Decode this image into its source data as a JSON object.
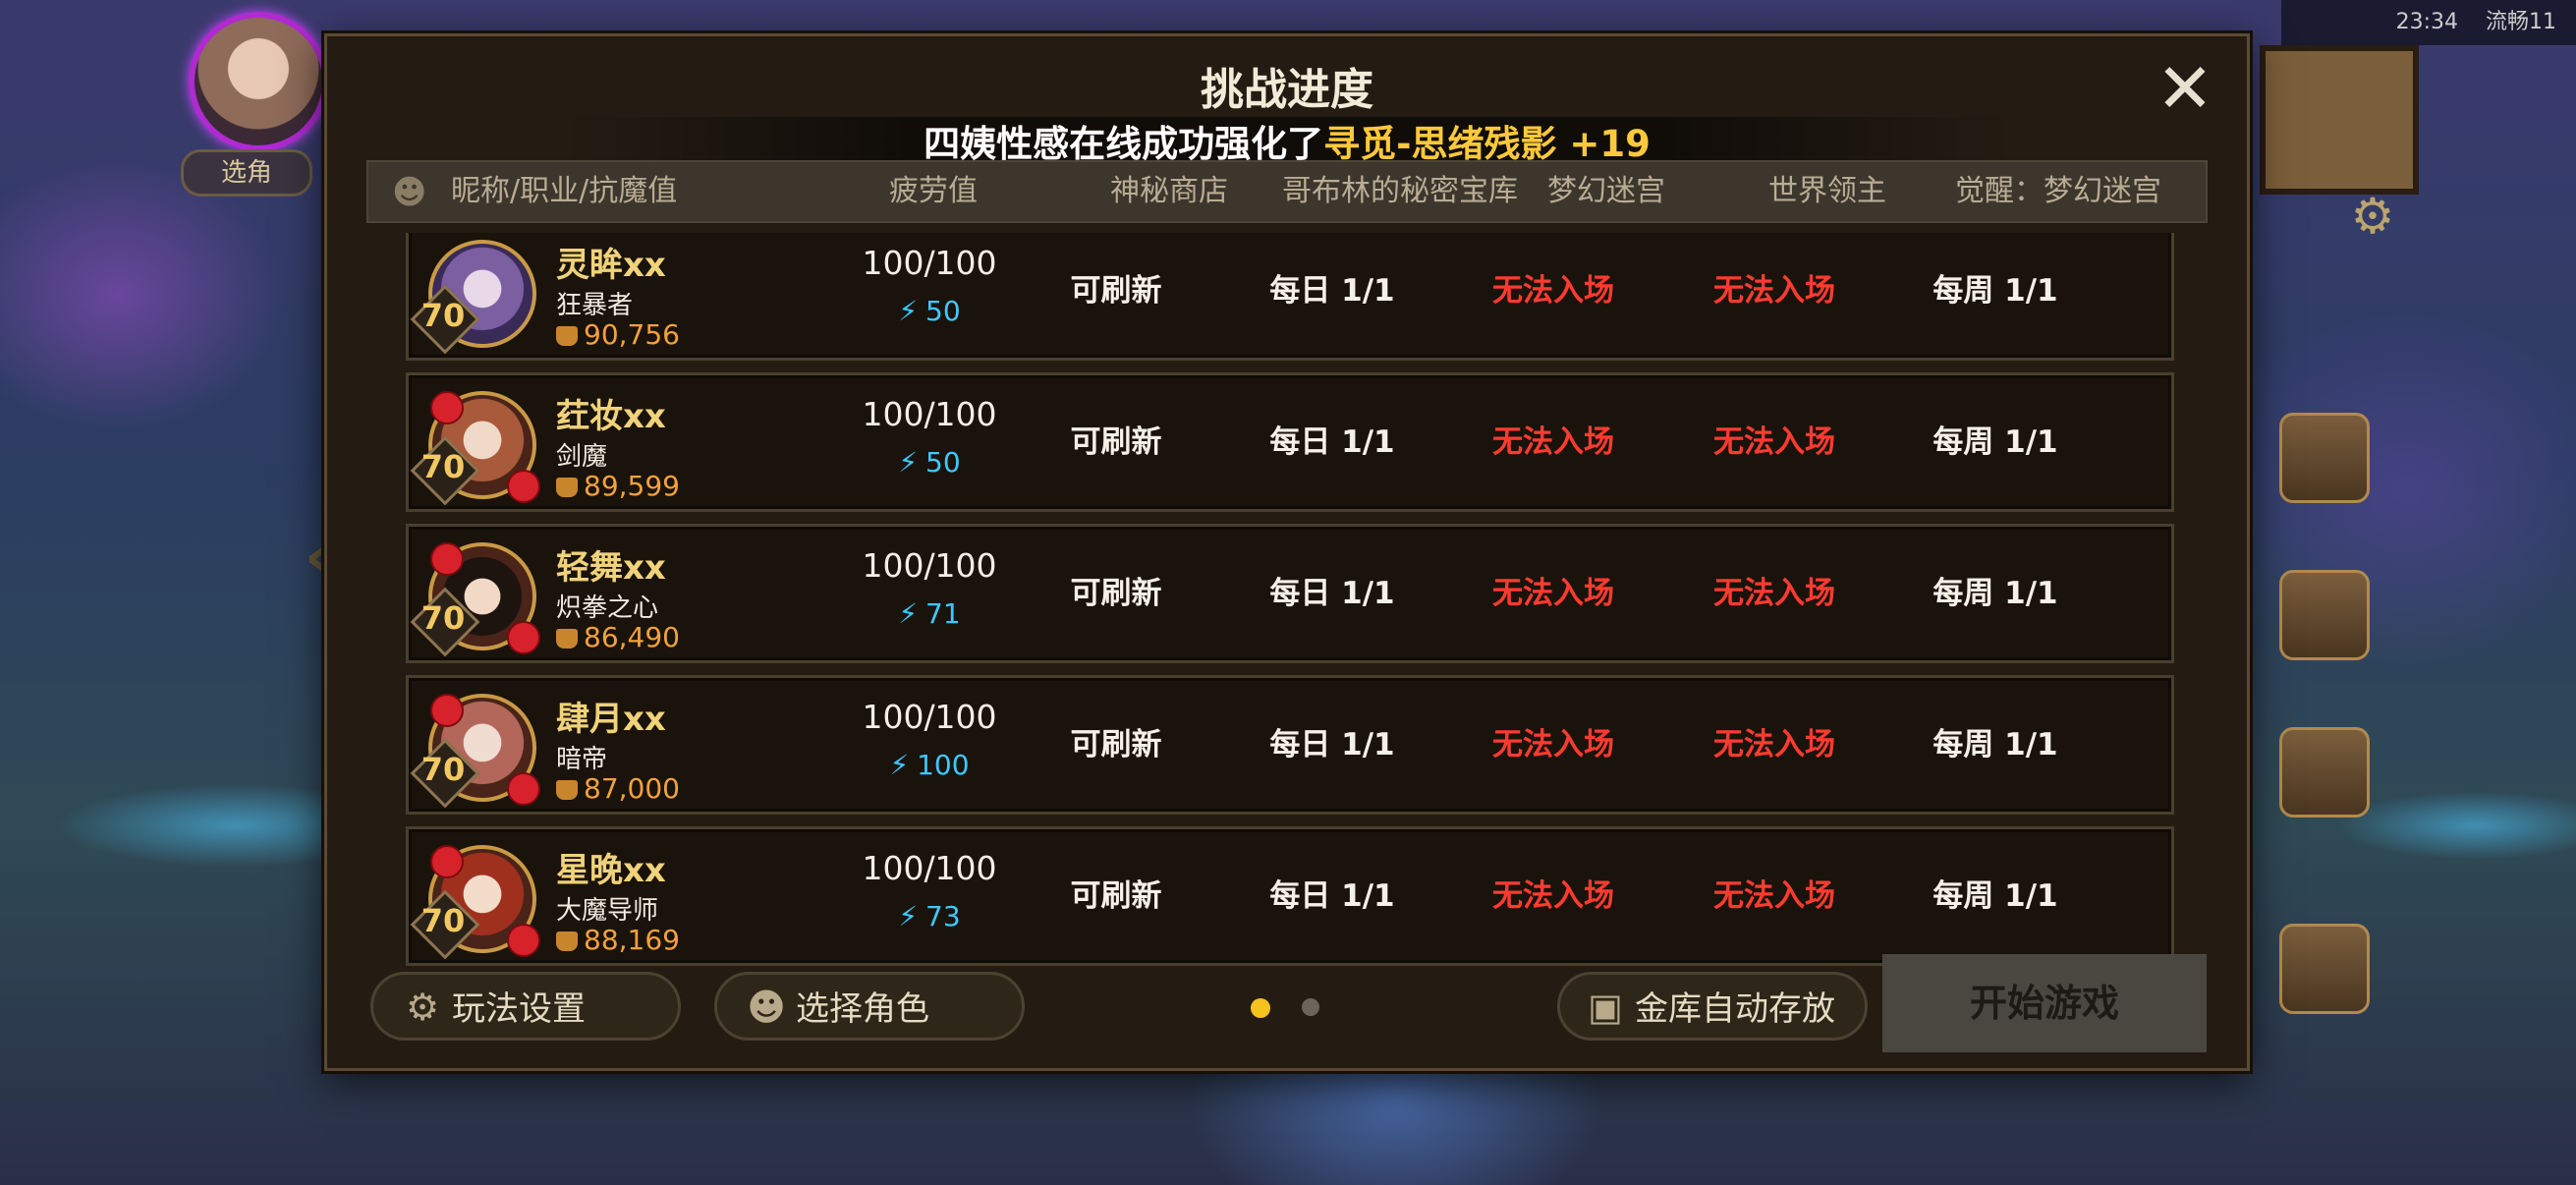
{
  "background": {
    "chip_label": "选角",
    "status_time": "23:34",
    "status_net": "流畅11"
  },
  "dialog": {
    "title": "挑战进度",
    "notice_prefix": "四姨性感在线成功强化了",
    "notice_highlight": "寻觅-思绪残影 +19",
    "columns": [
      "昵称/职业/抗魔值",
      "疲劳值",
      "神秘商店",
      "哥布林的秘密宝库",
      "梦幻迷宫",
      "世界领主",
      "觉醒：梦幻迷宫"
    ],
    "rows": [
      {
        "name": "灵眸xx",
        "job": "狂暴者",
        "power": "90,756",
        "level": "70",
        "fatigue": "100/100",
        "energy": "50",
        "shop": "可刷新",
        "goblin": "每日 1/1",
        "maze": "无法入场",
        "boss": "无法入场",
        "awaken": "每周 1/1"
      },
      {
        "name": "荭妆xx",
        "job": "剑魔",
        "power": "89,599",
        "level": "70",
        "fatigue": "100/100",
        "energy": "50",
        "shop": "可刷新",
        "goblin": "每日 1/1",
        "maze": "无法入场",
        "boss": "无法入场",
        "awaken": "每周 1/1"
      },
      {
        "name": "轻舞xx",
        "job": "炽拳之心",
        "power": "86,490",
        "level": "70",
        "fatigue": "100/100",
        "energy": "71",
        "shop": "可刷新",
        "goblin": "每日 1/1",
        "maze": "无法入场",
        "boss": "无法入场",
        "awaken": "每周 1/1"
      },
      {
        "name": "肆月xx",
        "job": "暗帝",
        "power": "87,000",
        "level": "70",
        "fatigue": "100/100",
        "energy": "100",
        "shop": "可刷新",
        "goblin": "每日 1/1",
        "maze": "无法入场",
        "boss": "无法入场",
        "awaken": "每周 1/1"
      },
      {
        "name": "星晚xx",
        "job": "大魔导师",
        "power": "88,169",
        "level": "70",
        "fatigue": "100/100",
        "energy": "73",
        "shop": "可刷新",
        "goblin": "每日 1/1",
        "maze": "无法入场",
        "boss": "无法入场",
        "awaken": "每周 1/1"
      }
    ],
    "buttons": {
      "settings": "玩法设置",
      "select_role": "选择角色",
      "vault": "金库自动存放",
      "start": "开始游戏"
    },
    "pagination": {
      "current": 1,
      "total": 2
    },
    "colors": {
      "accent": "#ffc93b",
      "warning": "#ff3b30",
      "energy": "#3ec8ff",
      "dot_active": "#f6c21c",
      "dot_inactive": "#6b655b"
    }
  }
}
